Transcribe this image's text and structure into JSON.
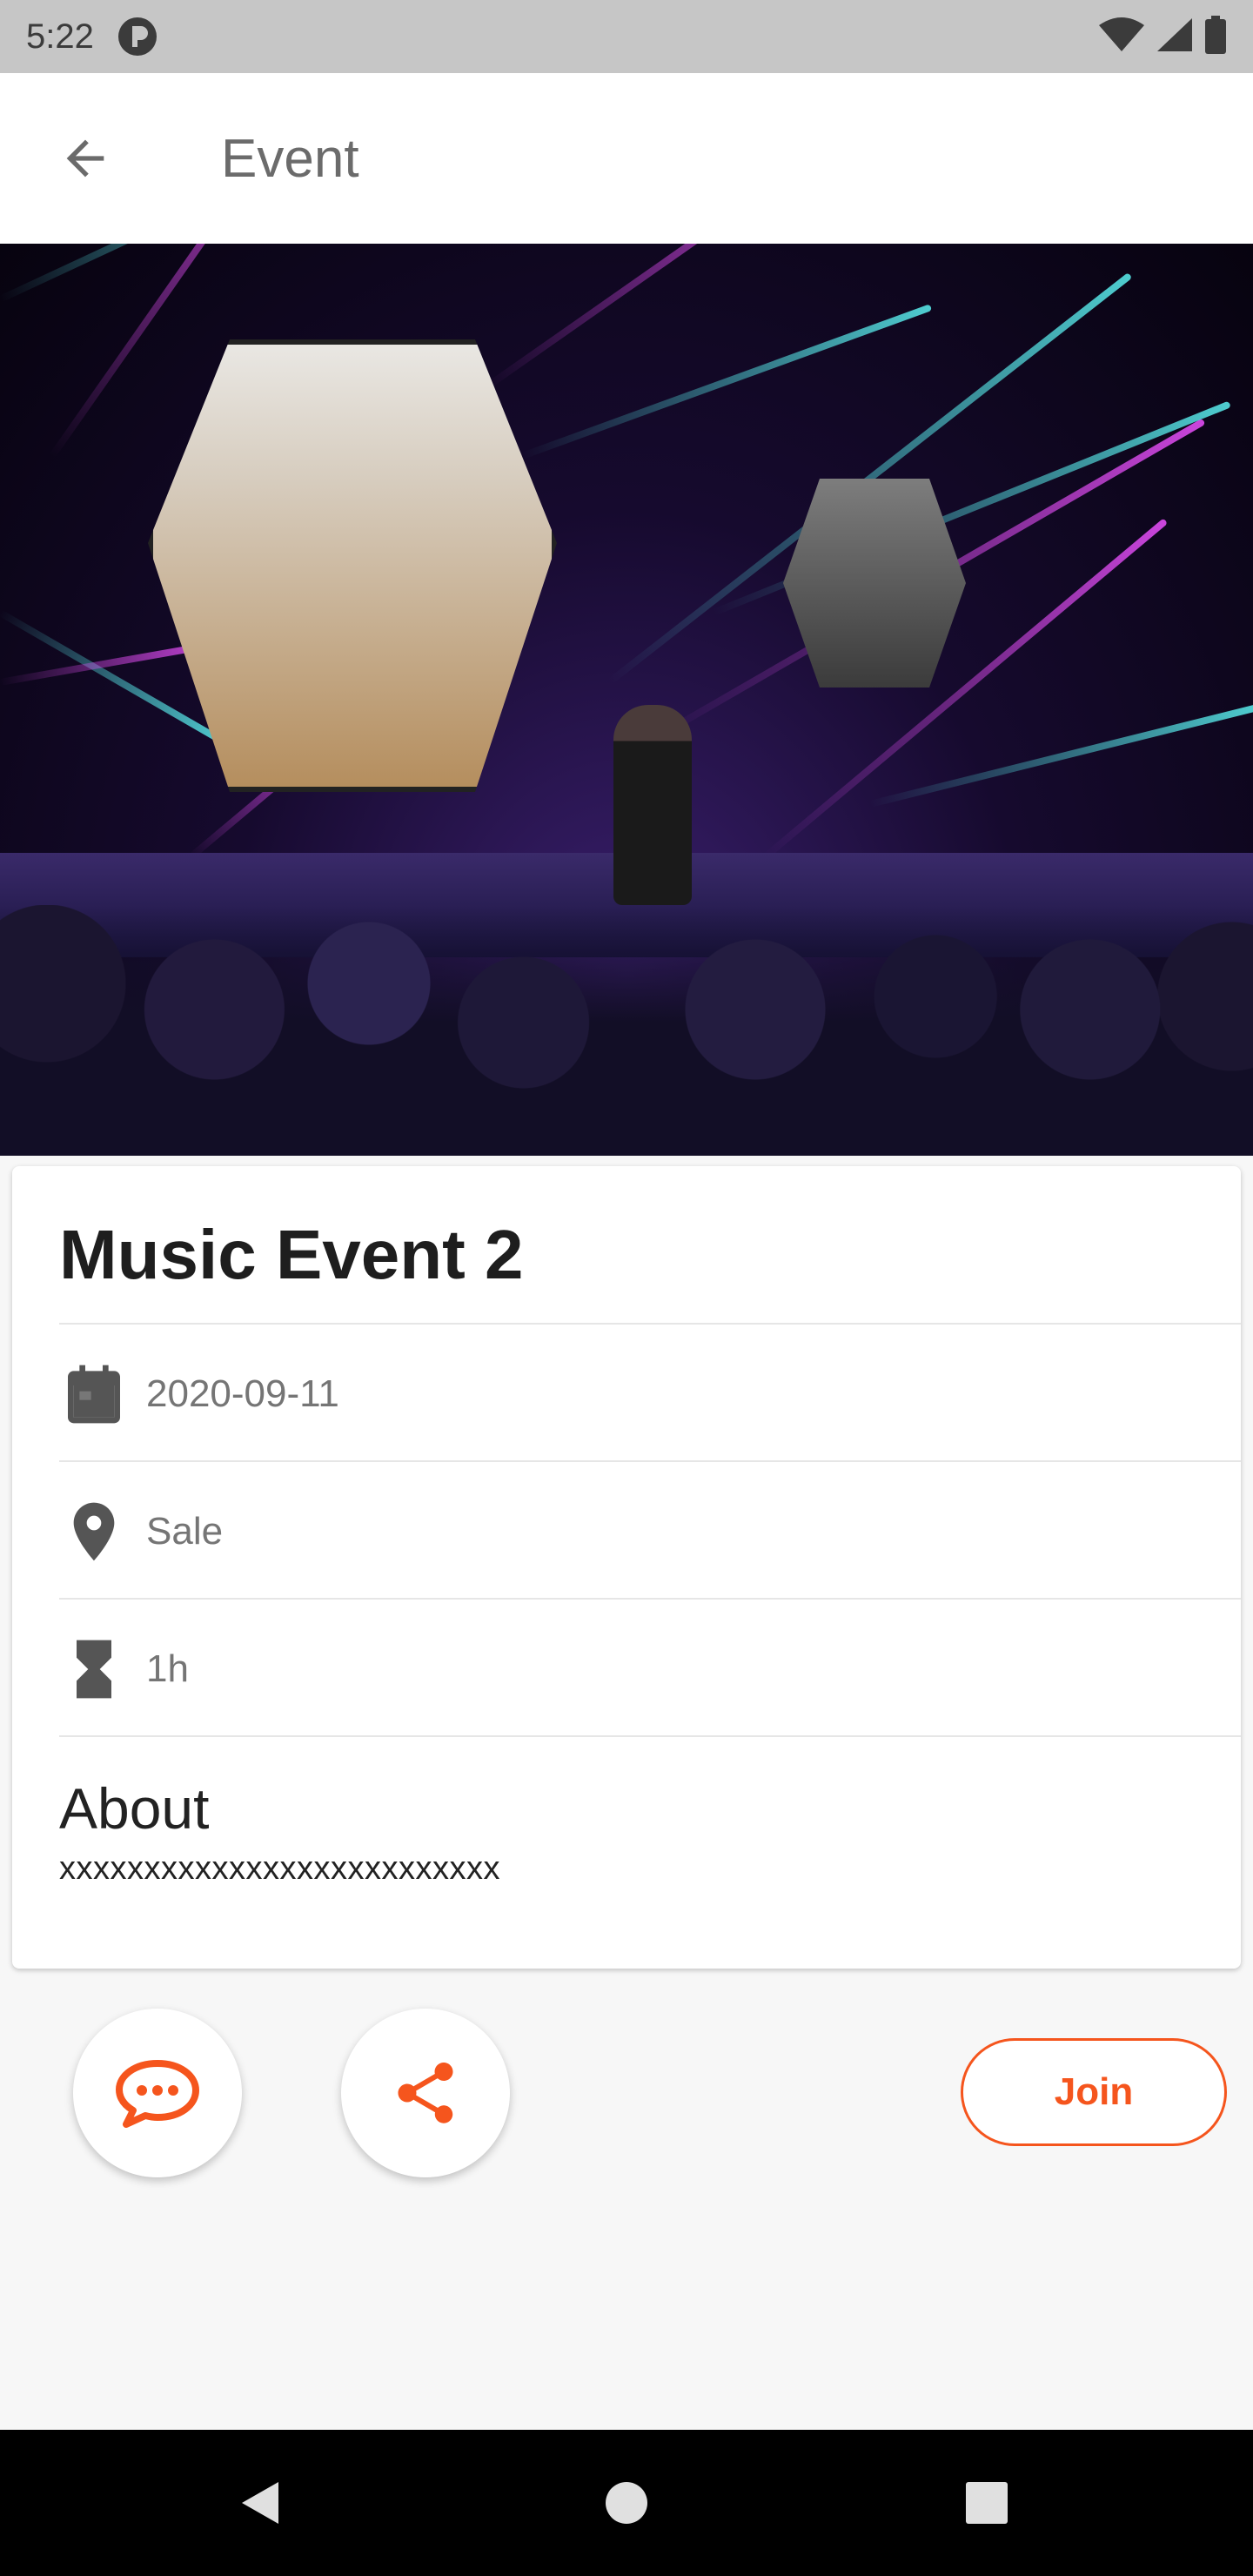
{
  "status_bar": {
    "time": "5:22",
    "icons": [
      "app-indicator-icon",
      "wifi-icon",
      "signal-icon",
      "battery-icon"
    ]
  },
  "app_bar": {
    "title": "Event",
    "back_icon": "arrow-back-icon"
  },
  "hero": {
    "icon": "event-photo"
  },
  "event": {
    "title": "Music Event 2",
    "date": "2020-09-11",
    "location": "Sale",
    "duration": "1h",
    "about_heading": "About",
    "about_text": "xxxxxxxxxxxxxxxxxxxxxxxxxx"
  },
  "actions": {
    "chat_icon": "chat-bubble-icon",
    "share_icon": "share-icon",
    "join_label": "Join"
  },
  "nav_bar": {
    "icons": [
      "nav-back-icon",
      "nav-home-icon",
      "nav-recents-icon"
    ]
  },
  "colors": {
    "accent": "#f5551d",
    "status_bar": "#c6c6c6",
    "background": "#f7f7f7"
  }
}
